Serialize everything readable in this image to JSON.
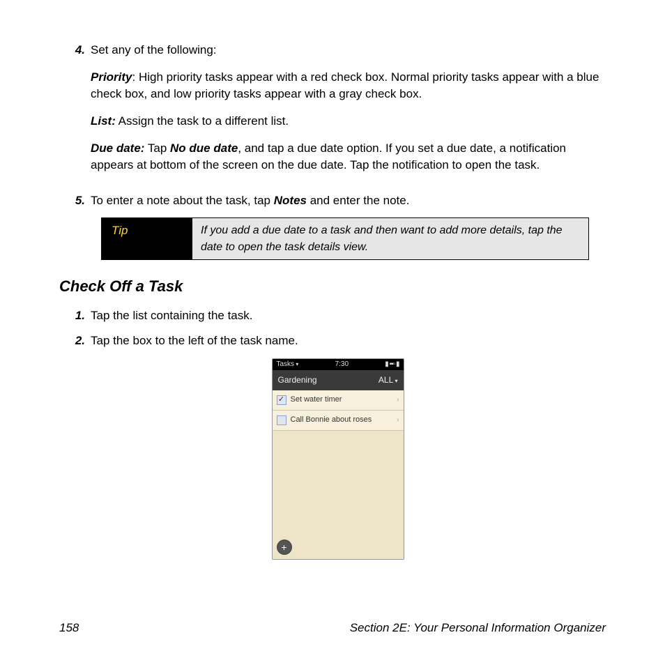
{
  "steps": {
    "s4": {
      "num": "4.",
      "intro": "Set any of the following:",
      "priority_label": "Priority",
      "priority_text": ": High priority tasks appear with a red check box. Normal priority tasks appear with a blue check box, and low priority tasks appear with a gray check box.",
      "list_label": "List:",
      "list_text": " Assign the task to a different list.",
      "due_label": "Due date:",
      "due_text_a": " Tap ",
      "due_em": "No due date",
      "due_text_b": ", and tap a due date option. If you set a due date, a notification appears at bottom of the screen on the due date. Tap the notification to open the task."
    },
    "s5": {
      "num": "5.",
      "text_a": "To enter a note about the task, tap ",
      "em": "Notes",
      "text_b": " and enter the note."
    }
  },
  "tip": {
    "label": "Tip",
    "text": "If you add a due date to a task and then want to add more details, tap the date to open the task details view."
  },
  "section_heading": "Check Off a Task",
  "check_steps": {
    "c1": {
      "num": "1.",
      "text": "Tap the list containing the task."
    },
    "c2": {
      "num": "2.",
      "text": "Tap the box to the left of the task name."
    }
  },
  "shot": {
    "app": "Tasks",
    "time": "7:30",
    "signal": "▮ ▪▪▫ ▮",
    "title": "Gardening",
    "filter": "ALL",
    "task1": "Set water timer",
    "task2": "Call Bonnie about roses",
    "check": "✓",
    "add": "+"
  },
  "footer": {
    "page": "158",
    "section": "Section 2E: Your Personal Information Organizer"
  }
}
